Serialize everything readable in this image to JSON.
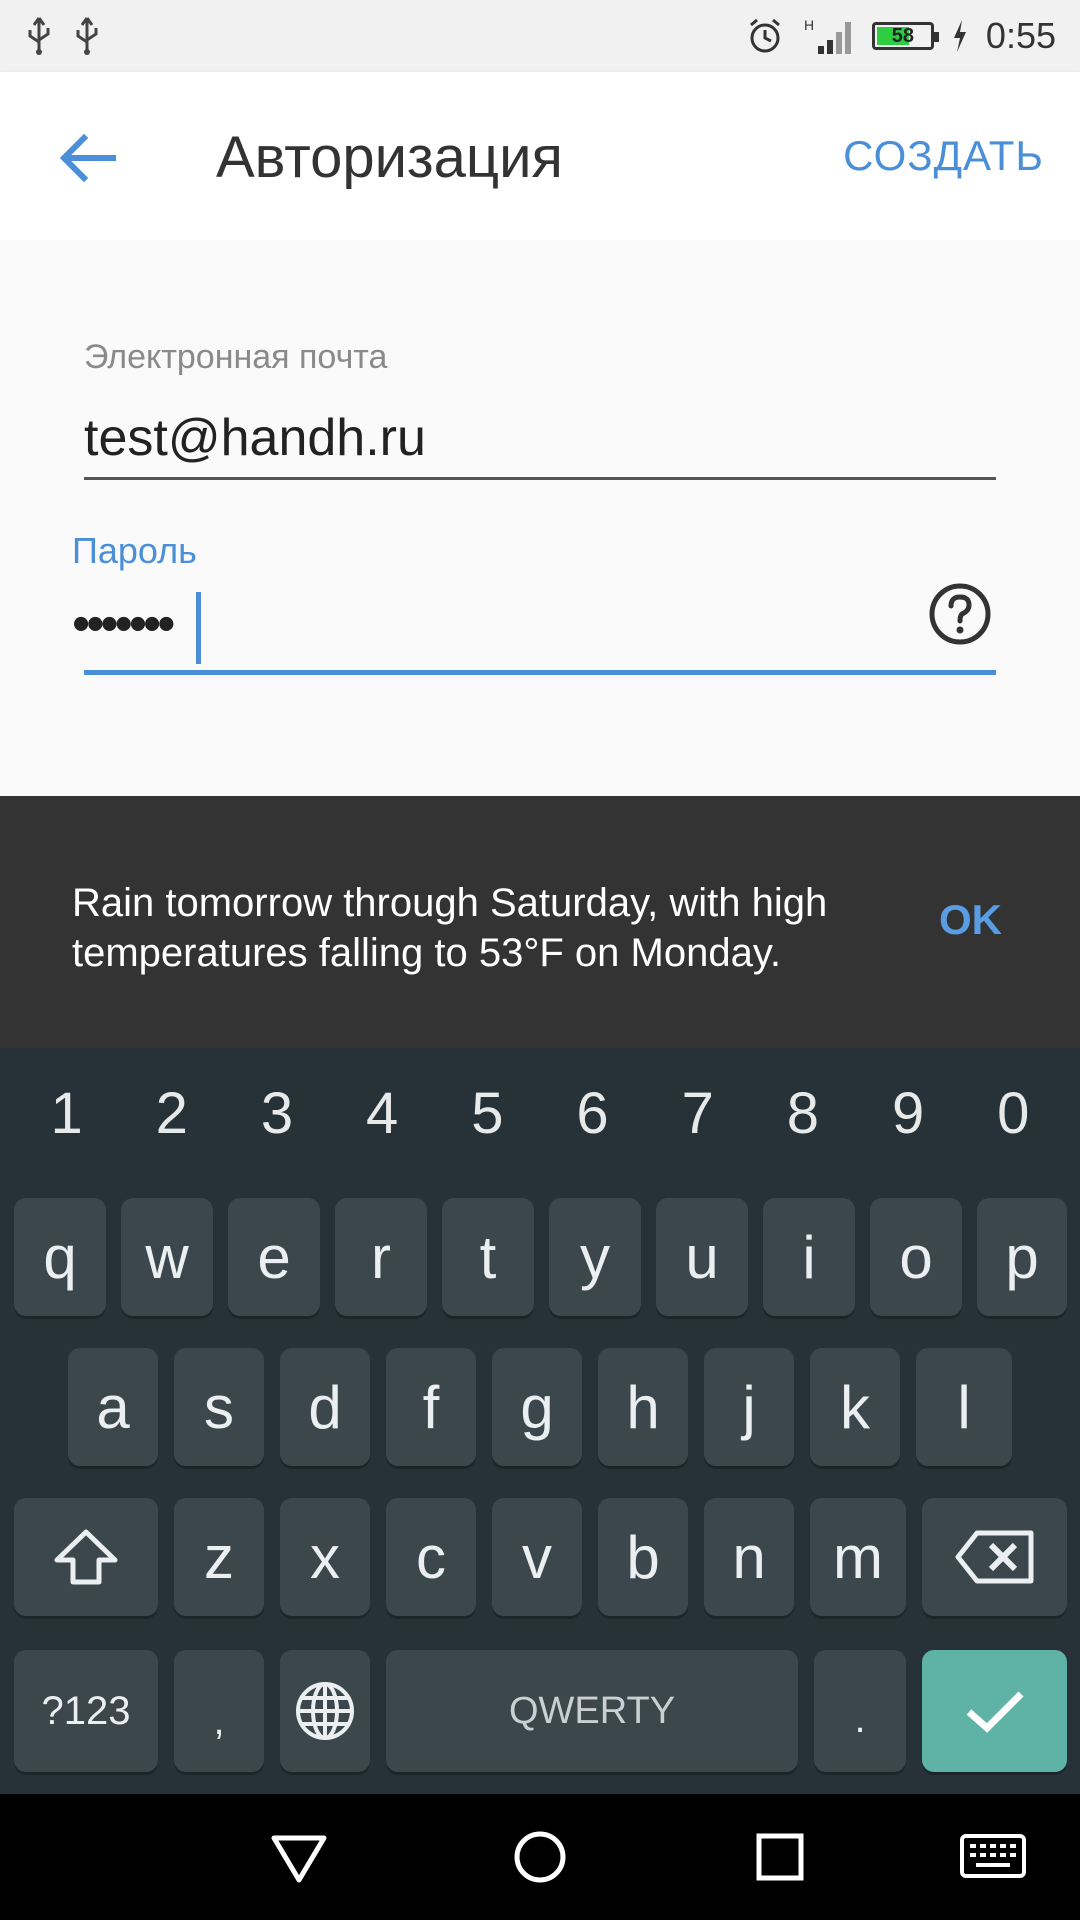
{
  "status_bar": {
    "time": "0:55",
    "battery_level": "58",
    "icons": [
      "usb-icon",
      "usb-icon",
      "alarm-icon",
      "signal-icon",
      "battery-icon",
      "charging-icon"
    ]
  },
  "app_bar": {
    "title": "Авторизация",
    "create_label": "СОЗДАТЬ"
  },
  "form": {
    "email_label": "Электронная почта",
    "email_value": "test@handh.ru",
    "password_label": "Пароль",
    "password_value": "•••••••"
  },
  "snackbar": {
    "message": "Rain tomorrow through Saturday, with high temperatures falling to 53°F on Monday.",
    "action_label": "OK"
  },
  "keyboard": {
    "numbers": [
      "1",
      "2",
      "3",
      "4",
      "5",
      "6",
      "7",
      "8",
      "9",
      "0"
    ],
    "row1": [
      "q",
      "w",
      "e",
      "r",
      "t",
      "y",
      "u",
      "i",
      "o",
      "p"
    ],
    "row2": [
      "a",
      "s",
      "d",
      "f",
      "g",
      "h",
      "j",
      "k",
      "l"
    ],
    "row3": [
      "z",
      "x",
      "c",
      "v",
      "b",
      "n",
      "m"
    ],
    "symbols_label": "?123",
    "comma_label": ",",
    "space_label": "QWERTY",
    "period_label": "."
  },
  "colors": {
    "accent": "#4a8fd8",
    "snackbar_bg": "#333333",
    "keyboard_bg": "#263238",
    "key_bg": "#3b474d",
    "enter_key_bg": "#5fb3a6"
  }
}
